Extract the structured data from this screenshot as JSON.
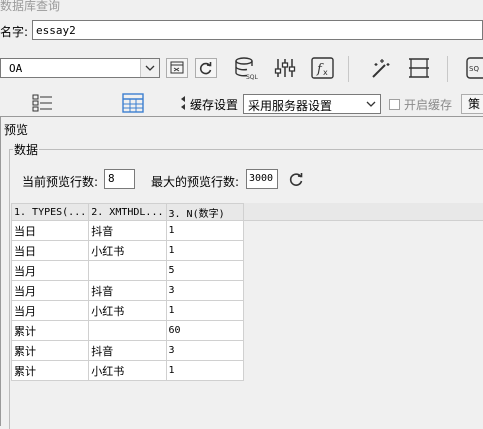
{
  "window": {
    "title": "数据库查询"
  },
  "name_field": {
    "label": "名字:",
    "value": "essay2"
  },
  "toolbar": {
    "connection_value": "OA",
    "icons": [
      "preview-icon",
      "refresh-icon",
      "sql-icon",
      "params-icon",
      "formula-icon",
      "wand-icon",
      "page-icon",
      "sql-editor-icon"
    ]
  },
  "row2": {
    "cache_label": "缓存设置",
    "cache_value": "采用服务器设置",
    "enable_cache_label": "开启缓存",
    "strategy_label": "策"
  },
  "preview": {
    "title": "预览",
    "section_label": "数据",
    "current_rows_label": "当前预览行数:",
    "current_rows_value": "8",
    "max_rows_label": "最大的预览行数:",
    "max_rows_value": "3000"
  },
  "table": {
    "headers": [
      "1. TYPES(...",
      "2. XMTHDL...",
      "3. N(数字)"
    ],
    "rows": [
      [
        "当日",
        "抖音",
        "1"
      ],
      [
        "当日",
        "小红书",
        "1"
      ],
      [
        "当月",
        "",
        "5"
      ],
      [
        "当月",
        "抖音",
        "3"
      ],
      [
        "当月",
        "小红书",
        "1"
      ],
      [
        "累计",
        "",
        "60"
      ],
      [
        "累计",
        "抖音",
        "3"
      ],
      [
        "累计",
        "小红书",
        "1"
      ]
    ]
  }
}
